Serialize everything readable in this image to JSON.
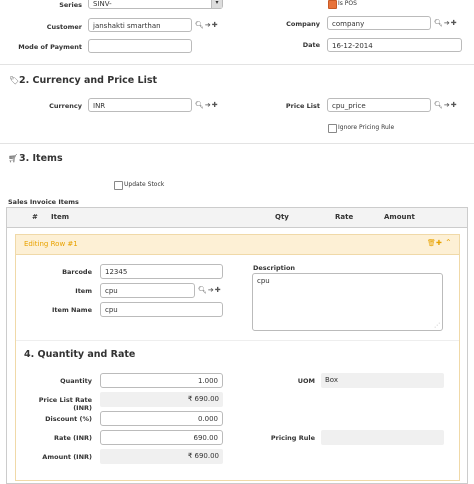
{
  "top": {
    "series_label": "Series",
    "series_value": "SINV-",
    "is_pos_label": "Is POS",
    "customer_label": "Customer",
    "customer_value": "janshakti smarthan",
    "company_label": "Company",
    "company_value": "company",
    "mop_label": "Mode of Payment",
    "mop_value": "",
    "date_label": "Date",
    "date_value": "16-12-2014"
  },
  "currency": {
    "title": "2. Currency and Price List",
    "currency_label": "Currency",
    "currency_value": "INR",
    "price_list_label": "Price List",
    "price_list_value": "cpu_price",
    "ignore_label": "Ignore Pricing Rule"
  },
  "items": {
    "title": "3. Items",
    "update_stock_label": "Update Stock",
    "table_title": "Sales Invoice Items",
    "columns": [
      "#",
      "Item",
      "Qty",
      "Rate",
      "Amount"
    ],
    "editing_label": "Editing Row #1",
    "barcode_label": "Barcode",
    "barcode_value": "12345",
    "item_label": "Item",
    "item_value": "cpu",
    "item_name_label": "Item Name",
    "item_name_value": "cpu",
    "description_label": "Description",
    "description_value": "cpu"
  },
  "qty": {
    "title": "4. Quantity and Rate",
    "quantity_label": "Quantity",
    "quantity_value": "1.000",
    "uom_label": "UOM",
    "uom_value": "Box",
    "plr_label": "Price List Rate (INR)",
    "plr_value": "₹ 690.00",
    "discount_label": "Discount (%)",
    "discount_value": "0.000",
    "rate_label": "Rate (INR)",
    "rate_value": "690.00",
    "pricing_rule_label": "Pricing Rule",
    "pricing_rule_value": "",
    "amount_label": "Amount (INR)",
    "amount_value": "₹ 690.00"
  },
  "icons": {
    "link_icons": "search-icon arrow-right-icon plus-icon",
    "tag": "tag-icon",
    "cart": "cart-icon"
  },
  "colors": {
    "editing_bg": "#fdf0d5",
    "editing_text": "#e8a200",
    "accent": "#e8733a"
  }
}
